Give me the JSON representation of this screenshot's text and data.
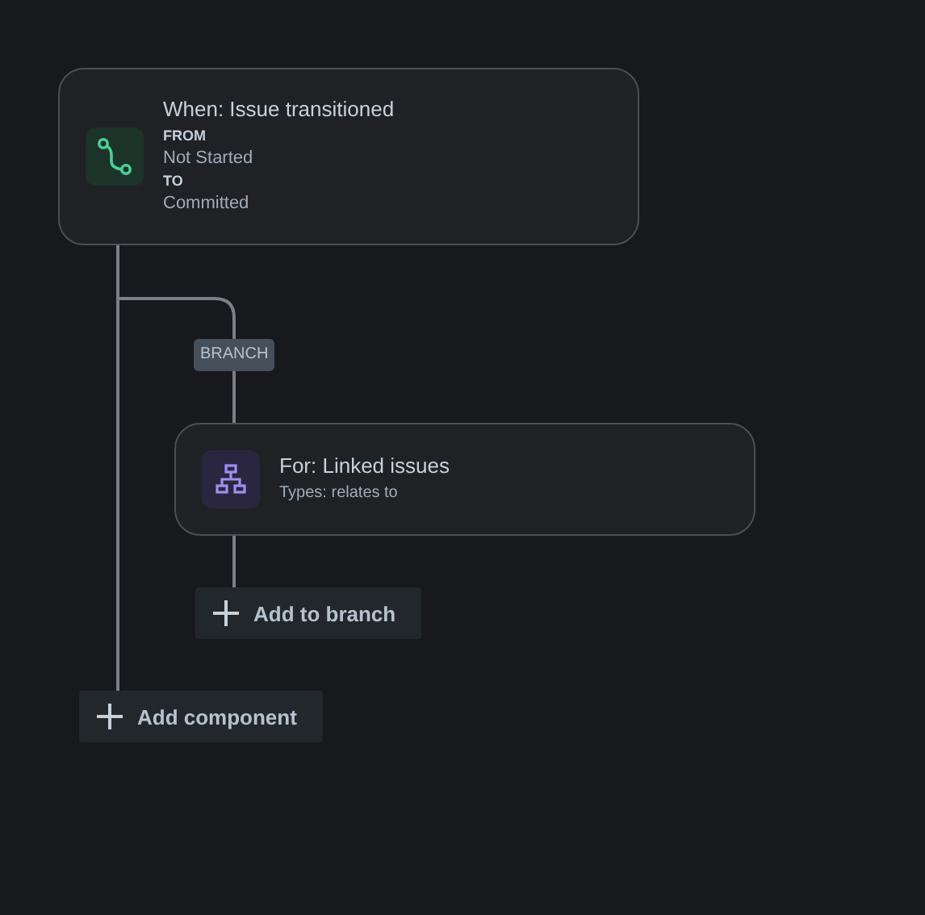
{
  "trigger": {
    "title": "When: Issue transitioned",
    "fields": [
      {
        "label": "FROM",
        "value": "Not Started"
      },
      {
        "label": "TO",
        "value": "Committed"
      }
    ]
  },
  "branch": {
    "tag": "BRANCH",
    "title": "For: Linked issues",
    "subtitle": "Types: relates to",
    "add_button": "Add to branch"
  },
  "add_button": "Add component"
}
